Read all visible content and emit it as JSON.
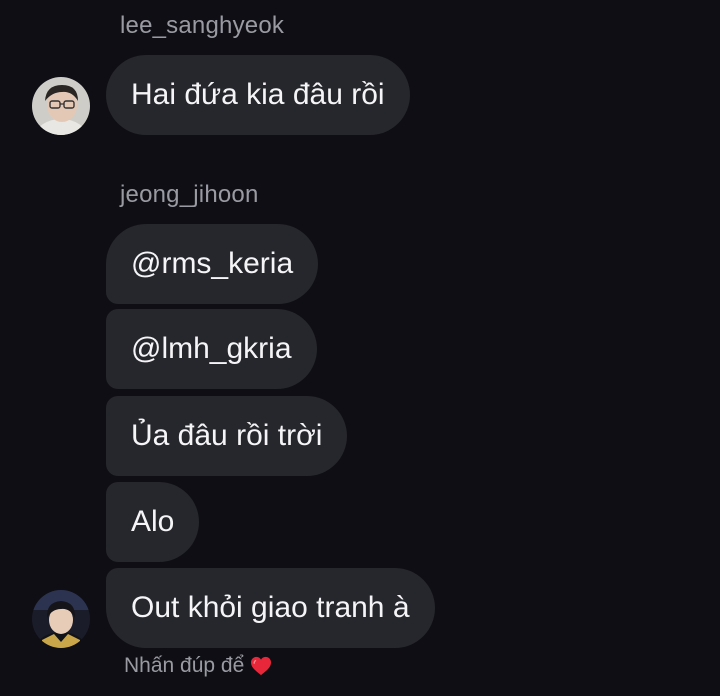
{
  "conversation": {
    "groups": [
      {
        "sender": "lee_sanghyeok",
        "avatar_icon": "user-avatar-photo",
        "messages": [
          "Hai đứa kia đâu rồi"
        ]
      },
      {
        "sender": "jeong_jihoon",
        "avatar_icon": "user-avatar-photo",
        "messages": [
          "@rms_keria",
          "@lmh_gkria",
          "Ủa đâu rồi trời",
          "Alo",
          "Out khỏi giao tranh à"
        ]
      }
    ],
    "hint": "Nhấn đúp để",
    "hint_icon": "heart-icon",
    "colors": {
      "background": "#0e0e14",
      "bubble": "#26272c",
      "secondary_text": "#9a9aa3",
      "heart": "#e8283a"
    }
  }
}
